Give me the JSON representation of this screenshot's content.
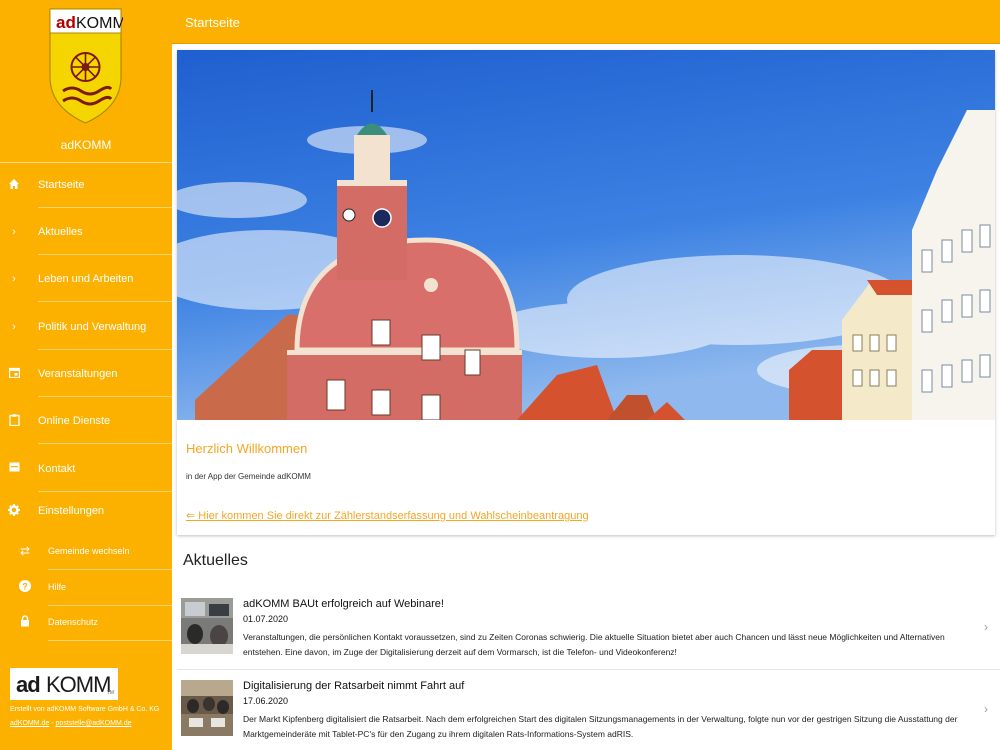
{
  "app": {
    "name": "adKOMM",
    "page_title": "Startseite"
  },
  "sidebar": {
    "items": [
      {
        "label": "Startseite",
        "icon": "home-icon"
      },
      {
        "label": "Aktuelles",
        "icon": "chevron-right-icon"
      },
      {
        "label": "Leben und Arbeiten",
        "icon": "chevron-right-icon"
      },
      {
        "label": "Politik und Verwaltung",
        "icon": "chevron-right-icon"
      },
      {
        "label": "Veranstaltungen",
        "icon": "calendar-icon"
      },
      {
        "label": "Online Dienste",
        "icon": "clipboard-icon"
      },
      {
        "label": "Kontakt",
        "icon": "contact-card-icon"
      },
      {
        "label": "Einstellungen",
        "icon": "gear-icon"
      }
    ],
    "sub_items": [
      {
        "label": "Gemeinde wechseln",
        "icon": "swap-icon"
      },
      {
        "label": "Hilfe",
        "icon": "help-icon"
      },
      {
        "label": "Datenschutz",
        "icon": "lock-icon"
      }
    ],
    "logo": {
      "part1": "ad",
      "part2": "KOMM",
      "tm": "TM"
    },
    "footer_credit": "Erstellt von adKOMM Software GmbH & Co. KG",
    "footer_link1": "adKOMM.de",
    "footer_sep": " - ",
    "footer_link2": "poststelle@adKOMM.de"
  },
  "welcome": {
    "title": "Herzlich Willkommen",
    "subtitle": "in der App der Gemeinde adKOMM",
    "link": "⇐ Hier kommen Sie direkt zur Zählerstandserfassung und Wahlscheinbeantragung"
  },
  "news": {
    "heading": "Aktuelles",
    "items": [
      {
        "title": "adKOMM BAUt erfolgreich auf Webinare!",
        "date": "01.07.2020",
        "text": "Veranstaltungen, die persönlichen Kontakt voraussetzen, sind zu Zeiten Coronas schwierig. Die aktuelle Situation bietet aber auch Chancen und lässt neue Möglichkeiten und Alternativen entstehen. Eine davon, im Zuge der Digitalisierung derzeit auf dem Vormarsch, ist die Telefon- und Videokonferenz!"
      },
      {
        "title": "Digitalisierung der Ratsarbeit nimmt Fahrt auf",
        "date": "17.06.2020",
        "text": "Der Markt Kipfenberg digitalisiert die Ratsarbeit. Nach dem erfolgreichen Start des digitalen Sitzungsmanagements in der Verwaltung, folgte nun vor der gestrigen Sitzung die Ausstattung der Marktgemeinderäte mit Tablet-PC's für den Zugang zu ihrem digitalen Rats-Informations-System adRIS."
      }
    ]
  },
  "colors": {
    "brand": "#fcb100",
    "accent_text": "#f5a623"
  }
}
